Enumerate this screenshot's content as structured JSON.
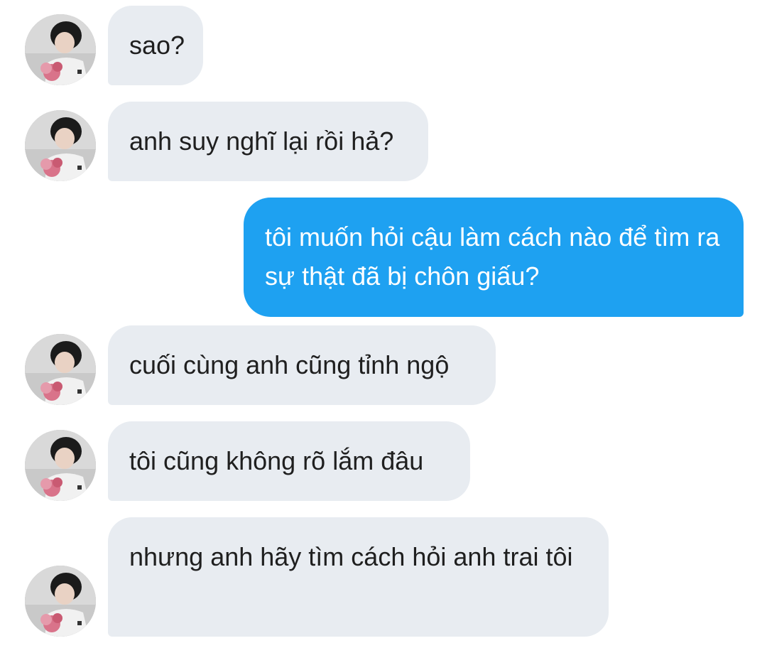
{
  "conversation": {
    "messages": [
      {
        "direction": "incoming",
        "text": "sao?",
        "avatar_icon": "user-avatar-icon"
      },
      {
        "direction": "incoming",
        "text": "anh suy nghĩ lại rồi hả?",
        "avatar_icon": "user-avatar-icon"
      },
      {
        "direction": "outgoing",
        "text": "tôi muốn hỏi cậu làm cách nào để tìm ra sự thật đã bị chôn giấu?"
      },
      {
        "direction": "incoming",
        "text": "cuối cùng anh cũng tỉnh ngộ",
        "avatar_icon": "user-avatar-icon"
      },
      {
        "direction": "incoming",
        "text": "tôi cũng không rõ lắm đâu",
        "avatar_icon": "user-avatar-icon"
      },
      {
        "direction": "incoming",
        "text": "nhưng anh hãy tìm cách hỏi anh trai tôi",
        "avatar_icon": "user-avatar-icon"
      }
    ]
  },
  "colors": {
    "incoming_bubble": "#e8ecf1",
    "outgoing_bubble": "#1ea1f1",
    "incoming_text": "#1f1f1f",
    "outgoing_text": "#ffffff"
  }
}
